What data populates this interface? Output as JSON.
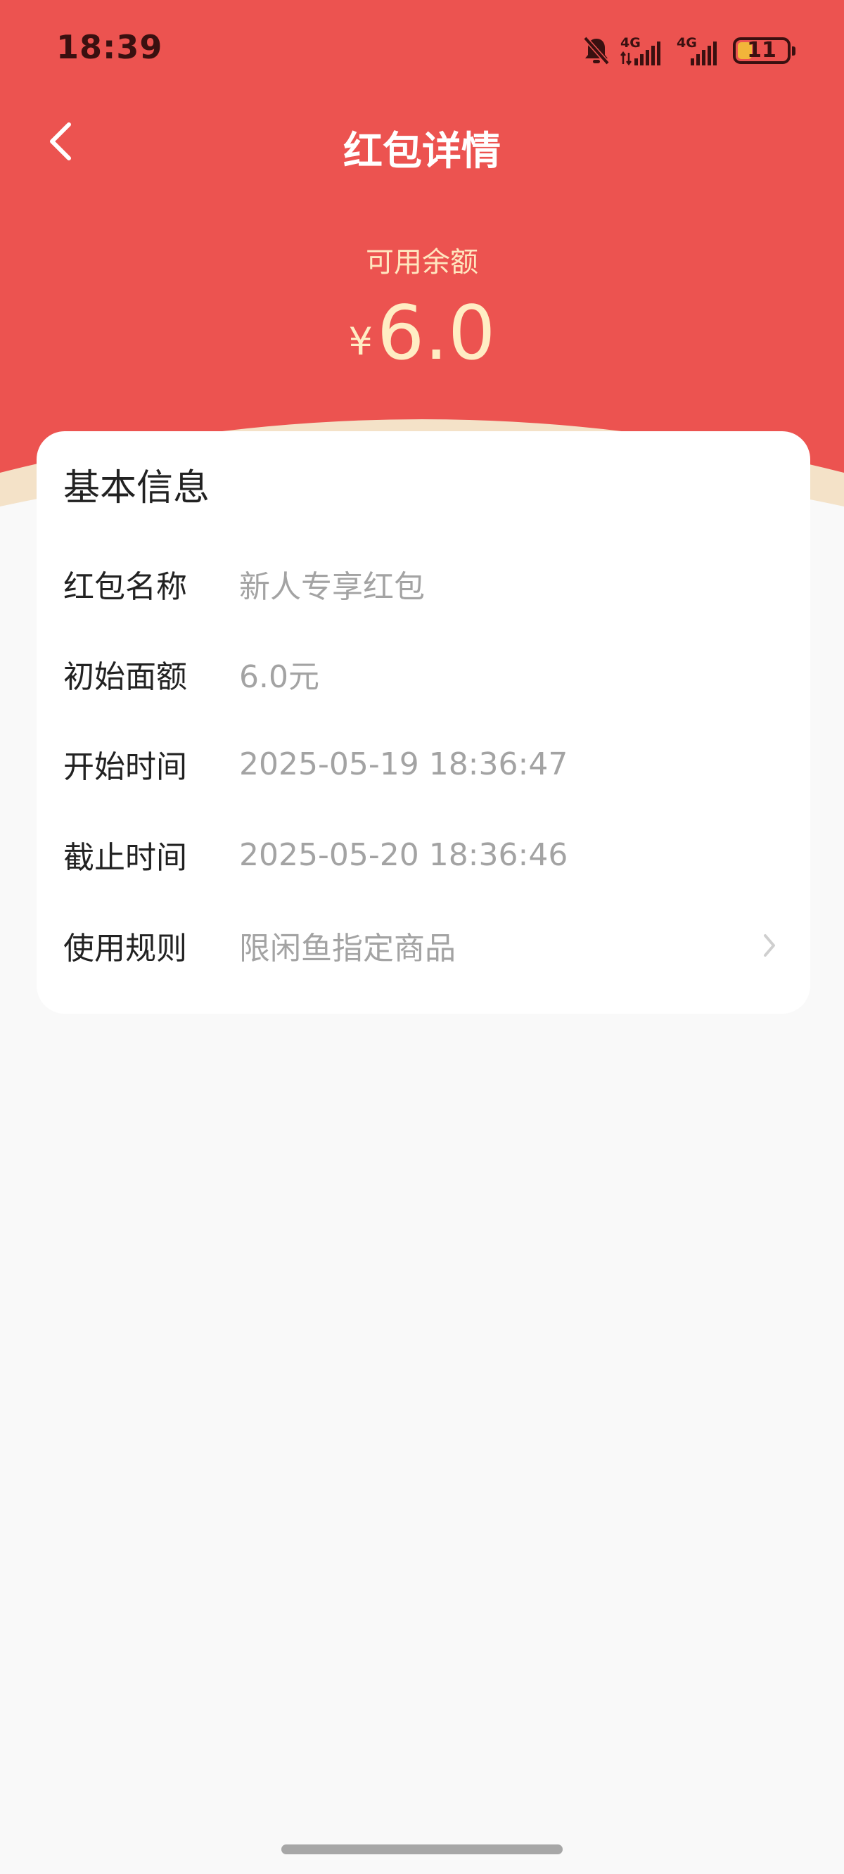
{
  "colors": {
    "header_red": "#ec5350",
    "header_edge": "#f4e2c8",
    "balance_text": "#ffedc4",
    "page_background": "#f9f9f9"
  },
  "status_bar": {
    "time": "18:39",
    "network_1": "4G",
    "network_2": "4G",
    "battery_level": "11",
    "icons": [
      "bell-muted-icon",
      "signal-4g-icon",
      "signal-4g-icon",
      "battery-icon"
    ]
  },
  "nav": {
    "back_icon": "chevron-left-icon",
    "title": "红包详情"
  },
  "balance": {
    "label": "可用余额",
    "currency": "¥",
    "amount": "6.0"
  },
  "card": {
    "title": "基本信息",
    "rows": [
      {
        "label": "红包名称",
        "value": "新人专享红包"
      },
      {
        "label": "初始面额",
        "value": "6.0元"
      },
      {
        "label": "开始时间",
        "value": "2025-05-19 18:36:47"
      },
      {
        "label": "截止时间",
        "value": "2025-05-20 18:36:46"
      },
      {
        "label": "使用规则",
        "value": "限闲鱼指定商品"
      }
    ]
  }
}
